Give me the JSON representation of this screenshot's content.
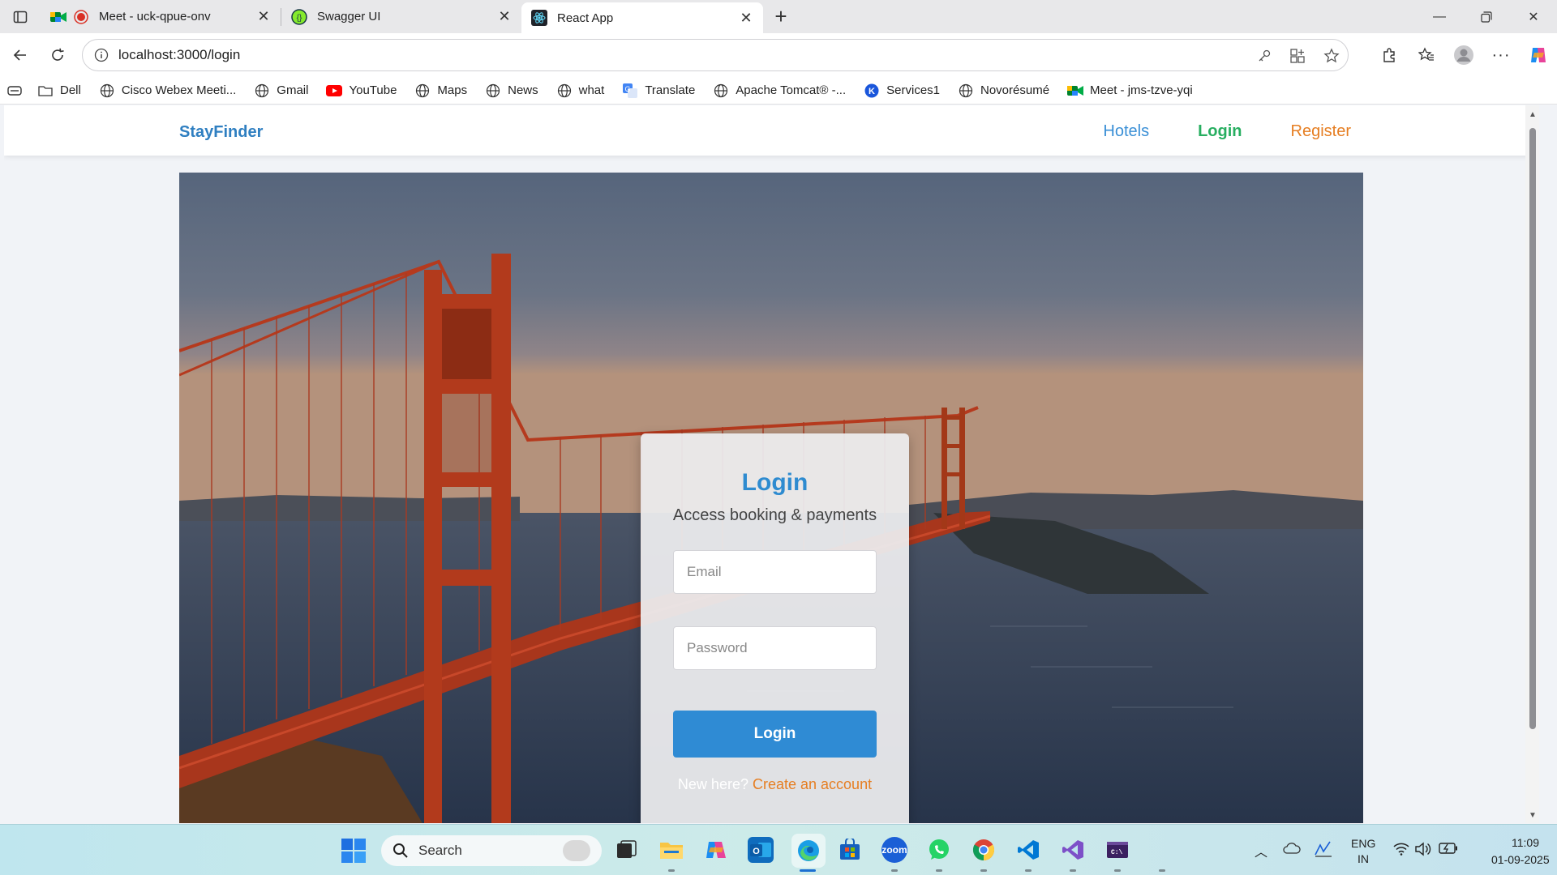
{
  "browser": {
    "tabs": [
      {
        "title": "Meet - uck-qpue-onv",
        "icon": "google-meet-icon"
      },
      {
        "title": "Swagger UI",
        "icon": "swagger-icon"
      },
      {
        "title": "React App",
        "icon": "react-icon",
        "active": true
      }
    ],
    "url": "localhost:3000/login",
    "bookmarks": [
      {
        "label": "Dell",
        "icon": "folder-icon"
      },
      {
        "label": "Cisco Webex Meeti...",
        "icon": "globe-icon"
      },
      {
        "label": "Gmail",
        "icon": "globe-icon"
      },
      {
        "label": "YouTube",
        "icon": "youtube-icon"
      },
      {
        "label": "Maps",
        "icon": "globe-icon"
      },
      {
        "label": "News",
        "icon": "globe-icon"
      },
      {
        "label": "what",
        "icon": "globe-icon"
      },
      {
        "label": "Translate",
        "icon": "translate-icon"
      },
      {
        "label": "Apache Tomcat® -...",
        "icon": "globe-icon"
      },
      {
        "label": "Services1",
        "icon": "services-icon"
      },
      {
        "label": "Novorésumé",
        "icon": "globe-icon"
      },
      {
        "label": "Meet - jms-tzve-yqi",
        "icon": "google-meet-icon"
      }
    ]
  },
  "site": {
    "brand": "StayFinder",
    "nav": {
      "hotels": "Hotels",
      "login": "Login",
      "register": "Register"
    },
    "colors": {
      "brand": "#2f7fc1",
      "login_nav": "#27ae60",
      "register_nav": "#e67e22",
      "button": "#2f8bd4"
    }
  },
  "login_card": {
    "title": "Login",
    "subtitle": "Access booking & payments",
    "email_placeholder": "Email",
    "password_placeholder": "Password",
    "submit_label": "Login",
    "new_here": "New here?",
    "create_account": "Create an account"
  },
  "taskbar": {
    "search_label": "Search",
    "language": "ENG",
    "region": "IN",
    "time": "11:09",
    "date": "01-09-2025"
  }
}
